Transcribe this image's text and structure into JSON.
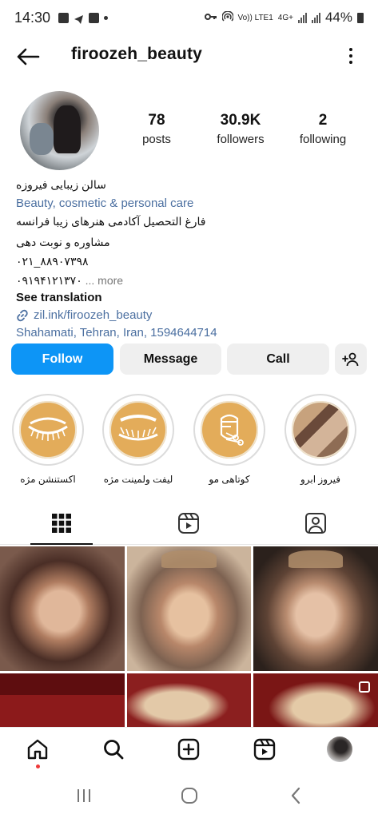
{
  "status_bar": {
    "time": "14:30",
    "network": "Vo)) LTE1",
    "network_type": "4G+",
    "battery": "44%"
  },
  "header": {
    "username": "firoozeh_beauty",
    "back_icon": "arrow-left-icon",
    "menu_icon": "more-vertical-icon"
  },
  "profile": {
    "stats": [
      {
        "value": "78",
        "label": "posts"
      },
      {
        "value": "30.9K",
        "label": "followers"
      },
      {
        "value": "2",
        "label": "following"
      }
    ],
    "bio": {
      "name": "سالن زیبایی فیروزه",
      "category": "Beauty, cosmetic & personal care",
      "line1": "فارغ التحصیل آکادمی هنرهای زیبا فرانسه",
      "line2": "مشاوره و نوبت دهی",
      "line3": "۰۲۱_۸۸۹۰۷۳۹۸",
      "line4": "۰۹۱۹۴۱۲۱۳۷۰",
      "more": "... more",
      "see_translation": "See translation",
      "link": "zil.ink/firoozeh_beauty",
      "address": "Shahamati, Tehran, Iran, 1594644714"
    }
  },
  "actions": {
    "follow": "Follow",
    "message": "Message",
    "call": "Call",
    "add_user_icon": "person-plus-icon"
  },
  "highlights": [
    {
      "label": "اکستنشن مژه",
      "icon": "eyelash-extension-icon"
    },
    {
      "label": "لیفت ولمینت مژه",
      "icon": "eyelash-lift-icon"
    },
    {
      "label": "کوتاهی مو",
      "icon": "haircut-icon"
    },
    {
      "label": "فیروز ابرو",
      "icon": "eyebrow-photo"
    }
  ],
  "tabs": [
    {
      "name": "grid",
      "icon": "grid-icon",
      "active": true
    },
    {
      "name": "reels",
      "icon": "reels-icon",
      "active": false
    },
    {
      "name": "tagged",
      "icon": "tagged-person-icon",
      "active": false
    }
  ],
  "bottom_nav": [
    {
      "name": "home",
      "icon": "home-icon"
    },
    {
      "name": "search",
      "icon": "search-icon"
    },
    {
      "name": "create",
      "icon": "plus-square-icon"
    },
    {
      "name": "reels",
      "icon": "reels-icon"
    },
    {
      "name": "profile",
      "icon": "profile-avatar"
    }
  ],
  "colors": {
    "follow_button": "#0d95f6",
    "link": "#4b6fa0",
    "highlight_fill": "#e3ac5a"
  }
}
